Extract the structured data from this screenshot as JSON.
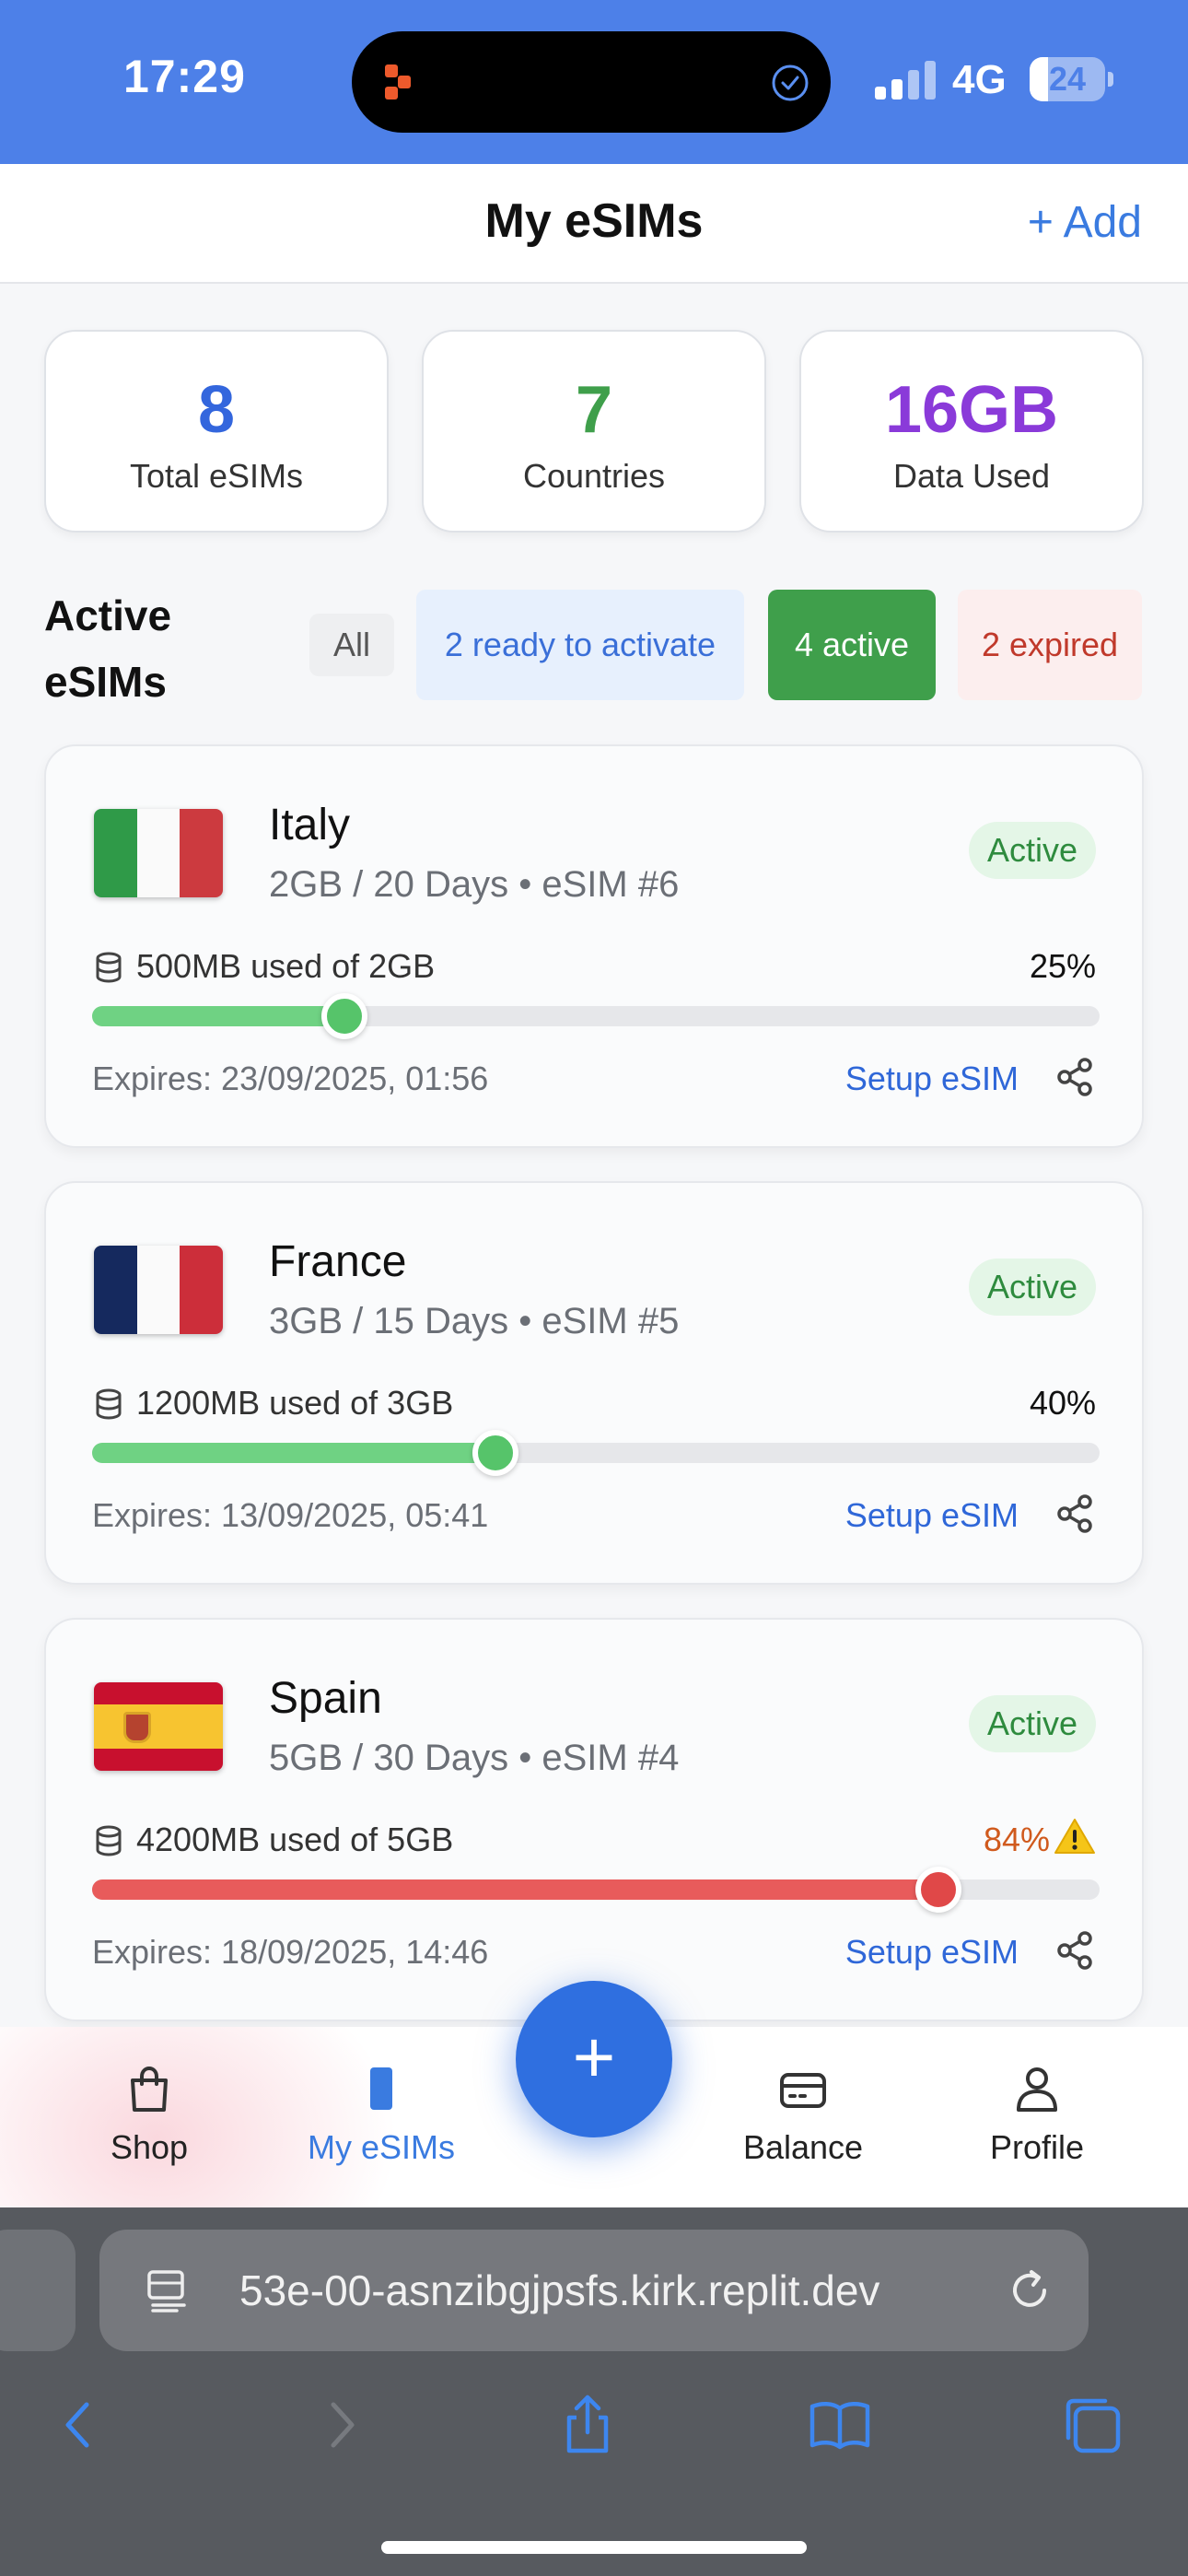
{
  "status_bar": {
    "time": "17:29",
    "network": "4G",
    "battery": "24",
    "battery_level": 0.24
  },
  "header": {
    "title": "My eSIMs",
    "add_label": "+ Add"
  },
  "stats": [
    {
      "value": "8",
      "label": "Total eSIMs",
      "color": "#3366dd"
    },
    {
      "value": "7",
      "label": "Countries",
      "color": "#3f9f4b"
    },
    {
      "value": "16GB",
      "label": "Data Used",
      "color": "#8a3ad9"
    }
  ],
  "filters": {
    "title": "Active eSIMs",
    "all": "All",
    "ready": "2 ready to activate",
    "active": "4 active",
    "expired": "2 expired"
  },
  "esims": [
    {
      "country": "Italy",
      "flag": "italy-flag",
      "plan": "2GB / 20 Days • eSIM #6",
      "status": "Active",
      "usage": "500MB used of 2GB",
      "percent": "25%",
      "percent_value": 25,
      "bar_color": "#6fd283",
      "knob_color": "#56c46a",
      "warning": false,
      "expires": "Expires: 23/09/2025, 01:56",
      "setup_label": "Setup eSIM"
    },
    {
      "country": "France",
      "flag": "france-flag",
      "plan": "3GB / 15 Days • eSIM #5",
      "status": "Active",
      "usage": "1200MB used of 3GB",
      "percent": "40%",
      "percent_value": 40,
      "bar_color": "#6fd283",
      "knob_color": "#56c46a",
      "warning": false,
      "expires": "Expires: 13/09/2025, 05:41",
      "setup_label": "Setup eSIM"
    },
    {
      "country": "Spain",
      "flag": "spain-flag",
      "plan": "5GB / 30 Days • eSIM #4",
      "status": "Active",
      "usage": "4200MB used of 5GB",
      "percent": "84%",
      "percent_value": 84,
      "bar_color": "#e85b5b",
      "knob_color": "#e04848",
      "warning": true,
      "expires": "Expires: 18/09/2025, 14:46",
      "setup_label": "Setup eSIM"
    }
  ],
  "nav": {
    "shop": "Shop",
    "my_esims": "My eSIMs",
    "fab": "+",
    "balance": "Balance",
    "profile": "Profile"
  },
  "browser": {
    "url": "53e-00-asnzibgjpsfs.kirk.replit.dev"
  }
}
